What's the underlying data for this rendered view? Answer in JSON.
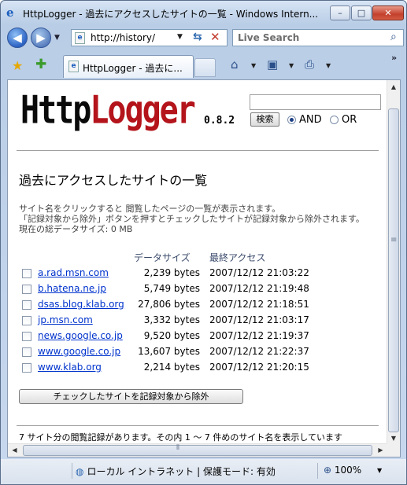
{
  "window": {
    "title": "HttpLogger - 過去にアクセスしたサイトの一覧 - Windows Intern...",
    "min": "–",
    "max": "□",
    "close": "✕"
  },
  "nav": {
    "back": "◀",
    "forward": "▶",
    "address": "http://history/",
    "search_placeholder": "Live Search"
  },
  "tabs": [
    {
      "label": "HttpLogger - 過去に..."
    }
  ],
  "page": {
    "logo_black": "Http",
    "logo_red": "Logger",
    "version": "0.8.2",
    "search_button": "検索",
    "radio_and": "AND",
    "radio_or": "OR",
    "heading": "過去にアクセスしたサイトの一覧",
    "desc": [
      "サイト名をクリックすると 閲覧したページの一覧が表示されます。",
      "「記録対象から除外」ボタンを押すとチェックしたサイトが記録対象から除外されます。",
      "現在の総データサイズ: 0 MB"
    ],
    "col_size": "データサイズ",
    "col_last": "最終アクセス",
    "rows": [
      {
        "site": "a.rad.msn.com",
        "size": "2,239 bytes",
        "time": "2007/12/12 21:03:22"
      },
      {
        "site": "b.hatena.ne.jp",
        "size": "5,749 bytes",
        "time": "2007/12/12 21:19:48"
      },
      {
        "site": "dsas.blog.klab.org",
        "size": "27,806 bytes",
        "time": "2007/12/12 21:18:51"
      },
      {
        "site": "jp.msn.com",
        "size": "3,332 bytes",
        "time": "2007/12/12 21:03:17"
      },
      {
        "site": "news.google.co.jp",
        "size": "9,520 bytes",
        "time": "2007/12/12 21:19:37"
      },
      {
        "site": "www.google.co.jp",
        "size": "13,607 bytes",
        "time": "2007/12/12 21:22:37"
      },
      {
        "site": "www.klab.org",
        "size": "2,214 bytes",
        "time": "2007/12/12 21:20:15"
      }
    ],
    "exclude_button": "チェックしたサイトを記録対象から除外",
    "footer": "7 サイト分の閲覧記録があります。その内 1 〜 7 件めのサイト名を表示しています"
  },
  "status": {
    "zone": "ローカル イントラネット | 保護モード: 有効",
    "zoom": "100%"
  }
}
